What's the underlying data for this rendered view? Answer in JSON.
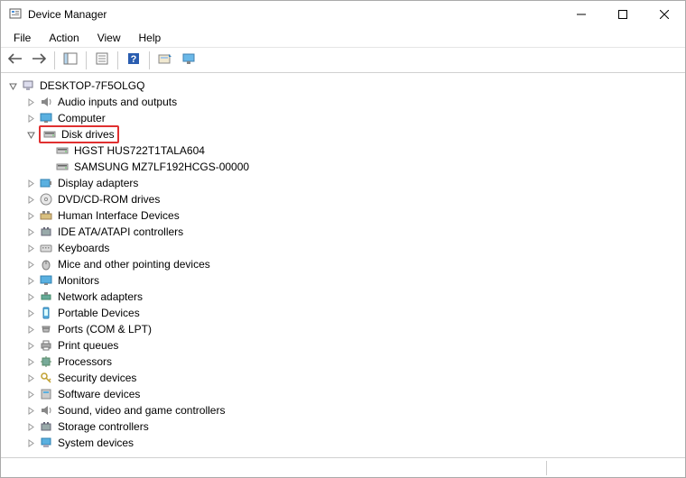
{
  "window": {
    "title": "Device Manager"
  },
  "menu": {
    "file": "File",
    "action": "Action",
    "view": "View",
    "help": "Help"
  },
  "tree": {
    "root": "DESKTOP-7F5OLGQ",
    "audio": "Audio inputs and outputs",
    "computer": "Computer",
    "disk_drives": "Disk drives",
    "disk_child1": "HGST HUS722T1TALA604",
    "disk_child2": "SAMSUNG MZ7LF192HCGS-00000",
    "display": "Display adapters",
    "dvd": "DVD/CD-ROM drives",
    "hid": "Human Interface Devices",
    "ide": "IDE ATA/ATAPI controllers",
    "keyboards": "Keyboards",
    "mice": "Mice and other pointing devices",
    "monitors": "Monitors",
    "network": "Network adapters",
    "portable": "Portable Devices",
    "ports": "Ports (COM & LPT)",
    "print": "Print queues",
    "processors": "Processors",
    "security": "Security devices",
    "software": "Software devices",
    "sound": "Sound, video and game controllers",
    "storage": "Storage controllers",
    "system": "System devices"
  }
}
